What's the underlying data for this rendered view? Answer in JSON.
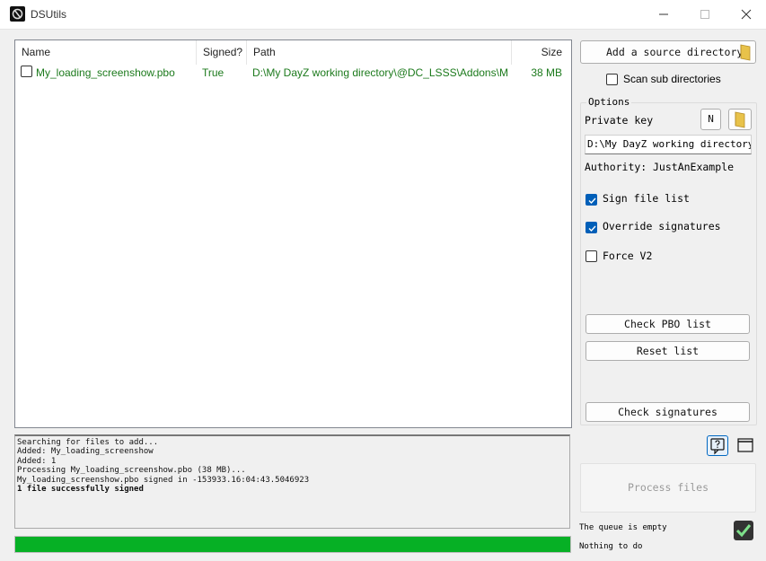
{
  "window": {
    "title": "DSUtils"
  },
  "file_list": {
    "columns": {
      "name": "Name",
      "signed": "Signed?",
      "path": "Path",
      "size": "Size"
    },
    "rows": [
      {
        "name": "My_loading_screenshow.pbo",
        "signed": "True",
        "path": "D:\\My DayZ working directory\\@DC_LSSS\\Addons\\M...",
        "size": "38 MB",
        "checked": false
      }
    ],
    "row_text_color": "#1c7a1c"
  },
  "log": {
    "lines": [
      {
        "text": "Searching for files to add...",
        "bold": false
      },
      {
        "text": "Added: My_loading_screenshow",
        "bold": false
      },
      {
        "text": "Added: 1",
        "bold": false
      },
      {
        "text": "Processing My_loading_screenshow.pbo (38 MB)...",
        "bold": false
      },
      {
        "text": "My_loading_screenshow.pbo signed in -153933.16:04:43.5046923",
        "bold": false
      },
      {
        "text": "1 file successfully signed",
        "bold": true
      }
    ]
  },
  "progress": {
    "value": 1.0,
    "color": "#06b025"
  },
  "panel": {
    "add_source_label": "Add a source directory",
    "scan_sub_label": "Scan sub directories",
    "scan_sub_checked": false,
    "options_legend": "Options",
    "private_key_label": "Private key",
    "n_button_label": "N",
    "key_path": "D:\\My DayZ working directory\\",
    "authority_label": "Authority:",
    "authority_value": "JustAnExample",
    "sign_file_list_label": "Sign file list",
    "sign_file_list_checked": true,
    "override_signatures_label": "Override signatures",
    "override_signatures_checked": true,
    "force_v2_label": "Force V2",
    "force_v2_checked": false,
    "check_pbo_label": "Check PBO list",
    "reset_list_label": "Reset list",
    "check_signatures_label": "Check signatures",
    "process_files_label": "Process files",
    "queue_status": "The queue is empty",
    "todo_status": "Nothing to do"
  },
  "icons": {
    "app": "app-icon",
    "folder": "folder-icon",
    "help": "help-icon",
    "window": "window-icon",
    "status": "checkmark-icon"
  },
  "colors": {
    "accent": "#005fb8",
    "success": "#06b025"
  }
}
